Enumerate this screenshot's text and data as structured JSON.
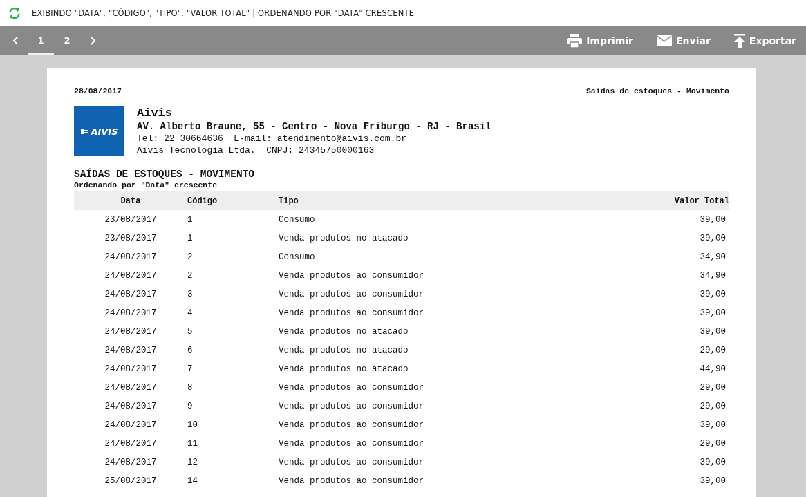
{
  "info_bar": {
    "text": "EXIBINDO \"DATA\", \"CÓDIGO\", \"TIPO\", \"VALOR TOTAL\" | ORDENANDO POR \"DATA\" CRESCENTE"
  },
  "pager": {
    "pages": [
      {
        "label": "1",
        "selected": true
      },
      {
        "label": "2",
        "selected": false
      }
    ]
  },
  "actions": [
    {
      "kind": "print",
      "label": "Imprimir"
    },
    {
      "kind": "mail",
      "label": "Enviar"
    },
    {
      "kind": "export",
      "label": "Exportar"
    }
  ],
  "report": {
    "date": "28/08/2017",
    "header_title": "Saídas de estoques - Movimento",
    "logo": {
      "text": "AIVIS"
    },
    "company": {
      "name": "Aivis",
      "address": "AV. Alberto Braune, 55 - Centro - Nova Friburgo - RJ - Brasil",
      "contact": "Tel: 22 30664636  E-mail: atendimento@aivis.com.br",
      "legal": "Aivis Tecnologia Ltda.  CNPJ: 24345750000163"
    },
    "title": "SAÍDAS DE ESTOQUES - MOVIMENTO",
    "subtitle": "Ordenando por \"Data\" crescente",
    "table": {
      "columns": [
        "Data",
        "Código",
        "Tipo",
        "Valor Total"
      ],
      "rows": [
        [
          "23/08/2017",
          "1",
          "Consumo",
          "39,00"
        ],
        [
          "23/08/2017",
          "1",
          "Venda produtos no atacado",
          "39,00"
        ],
        [
          "24/08/2017",
          "2",
          "Consumo",
          "34,90"
        ],
        [
          "24/08/2017",
          "2",
          "Venda produtos ao consumidor",
          "34,90"
        ],
        [
          "24/08/2017",
          "3",
          "Venda produtos ao consumidor",
          "39,00"
        ],
        [
          "24/08/2017",
          "4",
          "Venda produtos ao consumidor",
          "39,00"
        ],
        [
          "24/08/2017",
          "5",
          "Venda produtos no atacado",
          "39,00"
        ],
        [
          "24/08/2017",
          "6",
          "Venda produtos no atacado",
          "29,00"
        ],
        [
          "24/08/2017",
          "7",
          "Venda produtos no atacado",
          "44,90"
        ],
        [
          "24/08/2017",
          "8",
          "Venda produtos ao consumidor",
          "29,00"
        ],
        [
          "24/08/2017",
          "9",
          "Venda produtos ao consumidor",
          "29,00"
        ],
        [
          "24/08/2017",
          "10",
          "Venda produtos ao consumidor",
          "39,00"
        ],
        [
          "24/08/2017",
          "11",
          "Venda produtos ao consumidor",
          "29,00"
        ],
        [
          "24/08/2017",
          "12",
          "Venda produtos ao consumidor",
          "39,00"
        ],
        [
          "25/08/2017",
          "14",
          "Venda produtos ao consumidor",
          "39,00"
        ]
      ]
    }
  }
}
